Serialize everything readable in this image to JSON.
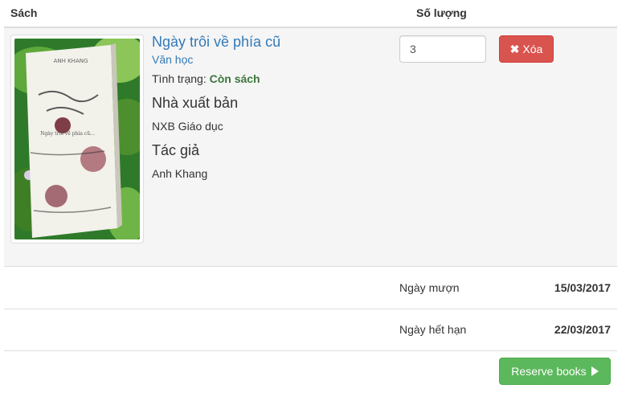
{
  "table": {
    "headers": {
      "book": "Sách",
      "quantity": "Số lượng"
    }
  },
  "item": {
    "cover_text": "ANH KHANG",
    "cover_title": "Ngày trôi về phía cũ...",
    "title": "Ngày trôi về phía cũ",
    "category": "Văn học",
    "status_label": "Tình trạng:",
    "status_value": "Còn sách",
    "publisher_heading": "Nhà xuất bản",
    "publisher": "NXB Giáo dục",
    "author_heading": "Tác giả",
    "author": "Anh Khang",
    "quantity": "3",
    "delete_label": "Xóa",
    "delete_icon": "times-icon"
  },
  "dates": [
    {
      "label": "Ngày mượn",
      "value": "15/03/2017"
    },
    {
      "label": "Ngày hết hạn",
      "value": "22/03/2017"
    }
  ],
  "actions": {
    "reserve_label": "Reserve books",
    "reserve_icon": "play-icon"
  },
  "colors": {
    "link": "#337ab7",
    "status_ok": "#3c763d",
    "danger": "#d9534f",
    "success": "#5cb85c",
    "row_bg": "#f5f5f5"
  }
}
